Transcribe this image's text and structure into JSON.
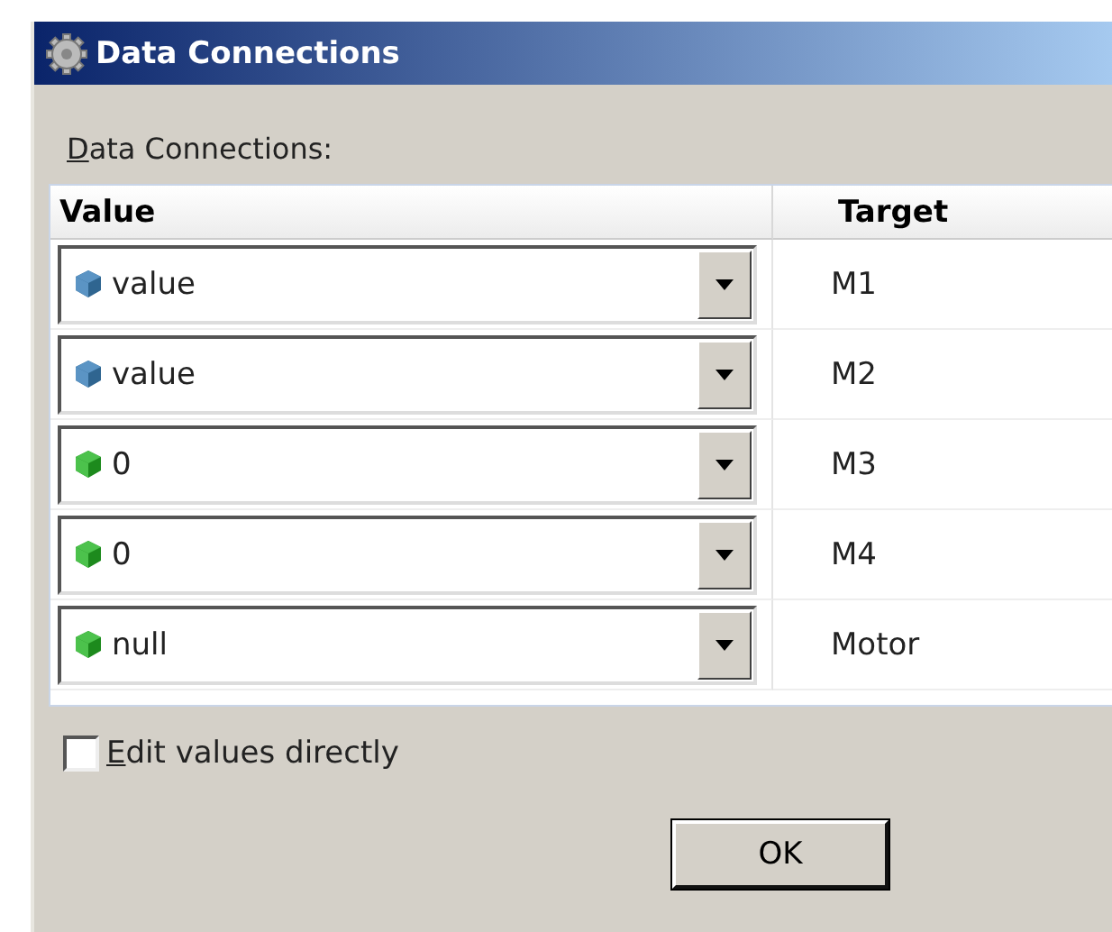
{
  "window": {
    "title": "Data Connections"
  },
  "label": "Data Connections:",
  "table": {
    "columns": [
      "Value",
      "Target"
    ],
    "rows": [
      {
        "value": "value",
        "kind": "variable",
        "target": "M1"
      },
      {
        "value": "value",
        "kind": "variable",
        "target": "M2"
      },
      {
        "value": "0",
        "kind": "constant",
        "target": "M3"
      },
      {
        "value": "0",
        "kind": "constant",
        "target": "M4"
      },
      {
        "value": "null",
        "kind": "constant",
        "target": "Motor"
      }
    ]
  },
  "edit_directly": {
    "label": "Edit values directly",
    "checked": false
  },
  "buttons": [
    "OK"
  ]
}
